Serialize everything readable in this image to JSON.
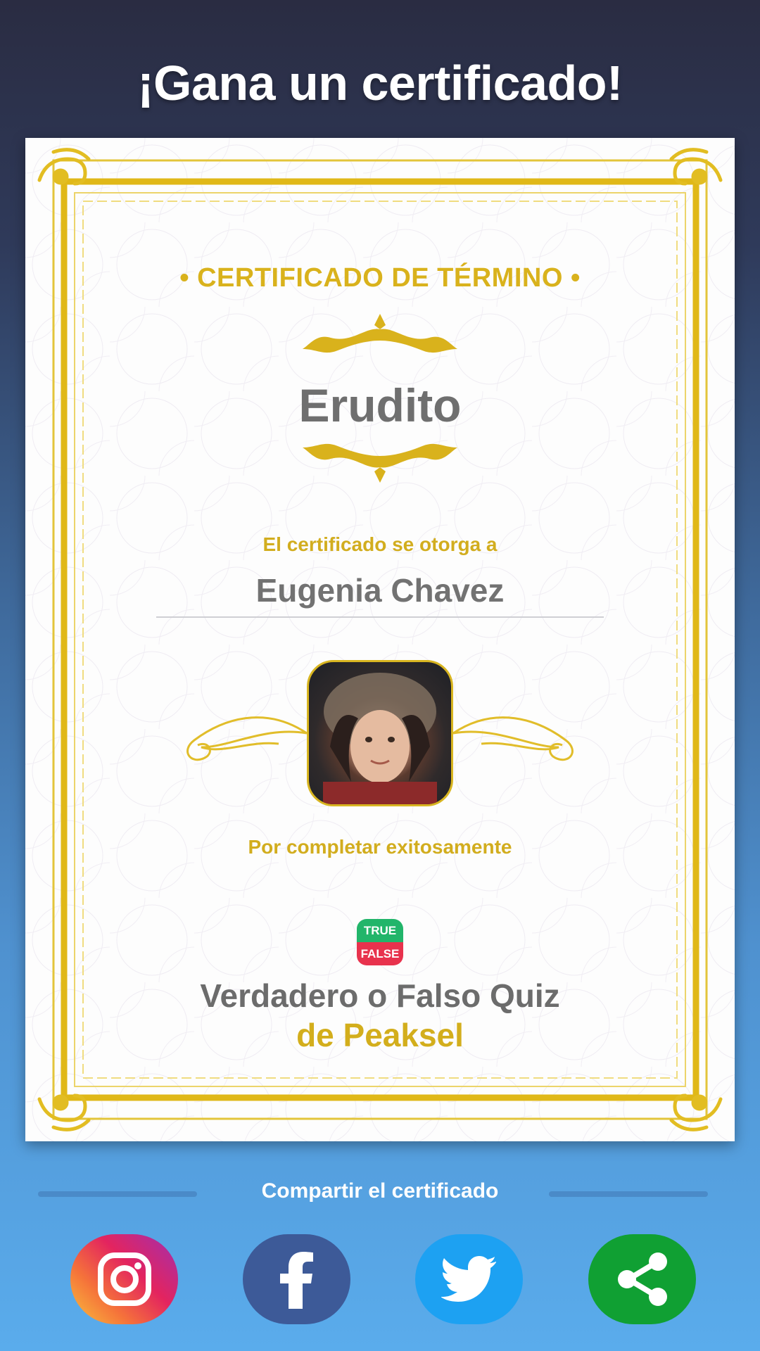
{
  "header": {
    "title": "¡Gana un certificado!"
  },
  "certificate": {
    "heading": "• CERTIFICADO DE TÉRMINO •",
    "title": "Erudito",
    "awarded_to_label": "El certificado se otorga a",
    "recipient_name": "Eugenia Chavez",
    "completion_label": "Por completar exitosamente",
    "app_badge": {
      "top_text": "TRUE",
      "bottom_text": "FALSE"
    },
    "app_name": "Verdadero o Falso Quiz",
    "app_developer": "de Peaksel"
  },
  "share": {
    "label": "Compartir el certificado",
    "buttons": [
      {
        "name": "instagram",
        "icon": "instagram-icon",
        "color": "#e3245f"
      },
      {
        "name": "facebook",
        "icon": "facebook-icon",
        "color": "#3d5a98"
      },
      {
        "name": "twitter",
        "icon": "twitter-icon",
        "color": "#1da1f2"
      },
      {
        "name": "share",
        "icon": "share-icon",
        "color": "#10a033"
      }
    ]
  },
  "colors": {
    "gold": "#d9b21c",
    "dark_bg": "#2a2c42",
    "light_bg": "#5aacec"
  }
}
